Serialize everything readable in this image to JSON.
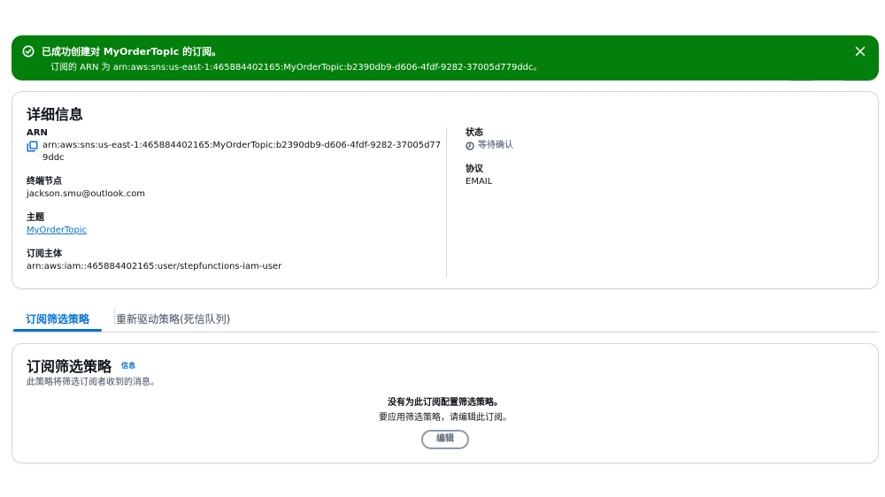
{
  "flash": {
    "title": "已成功创建对 MyOrderTopic 的订阅。",
    "message": "订阅的 ARN 为 arn:aws:sns:us-east-1:465884402165:MyOrderTopic:b2390db9-d606-4fdf-9282-37005d779ddc。",
    "status_color": "#037f0c",
    "icons": {
      "status": "success-check-icon",
      "close": "close-icon"
    }
  },
  "details": {
    "title": "详细信息",
    "arn_label": "ARN",
    "arn_value": "arn:aws:sns:us-east-1:465884402165:MyOrderTopic:b2390db9-d606-4fdf-9282-37005d779ddc",
    "endpoint_label": "终端节点",
    "endpoint_value": "jackson.smu@outlook.com",
    "topic_label": "主题",
    "topic_value": "MyOrderTopic",
    "principal_label": "订阅主体",
    "principal_value": "arn:aws:iam::465884402165:user/stepfunctions-iam-user",
    "status_label": "状态",
    "status_value": "等待确认",
    "protocol_label": "协议",
    "protocol_value": "EMAIL",
    "icons": {
      "copy": "copy-icon",
      "status": "clock-icon"
    }
  },
  "tabs": [
    {
      "label": "订阅筛选策略",
      "active": true
    },
    {
      "label": "重新驱动策略(死信队列)",
      "active": false
    }
  ],
  "filter_policy": {
    "title": "订阅筛选策略",
    "info_link": "信息",
    "description": "此策略将筛选订阅者收到的消息。",
    "empty_title": "没有为此订阅配置筛选策略。",
    "empty_subtitle": "要应用筛选策略，请编辑此订阅。",
    "edit_label": "编辑"
  },
  "colors": {
    "accent": "#0972d3",
    "success": "#037f0c",
    "border": "#d4d6da"
  }
}
